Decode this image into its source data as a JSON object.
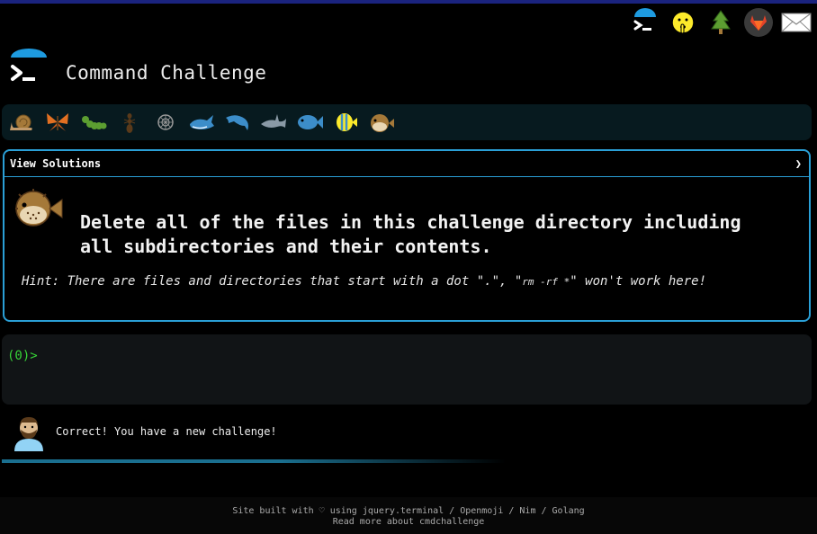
{
  "header": {
    "title": "Command Challenge"
  },
  "top_icons": [
    "terminal-icon",
    "shushing-face-icon",
    "evergreen-tree-icon",
    "gitlab-fox-icon",
    "envelope-icon"
  ],
  "creatures": [
    "snail-icon",
    "butterfly-icon",
    "caterpillar-icon",
    "ant-icon",
    "shell-icon",
    "whale-icon",
    "dolphin-icon",
    "shark-icon",
    "fish-icon",
    "tropical-fish-icon",
    "pufferfish-icon"
  ],
  "panel": {
    "header_label": "View Solutions",
    "chevron": "❯",
    "description": "Delete all of the files in this challenge directory including all subdirectories and their contents.",
    "hint_pre": "Hint: There are files and directories that start with a dot \".\", \"",
    "hint_code": "rm -rf *",
    "hint_post": "\" won't work here!"
  },
  "terminal": {
    "prompt": "(0)>"
  },
  "feedback": {
    "message": "Correct! You have a new challenge!"
  },
  "footer": {
    "line1": "Site built with ♡ using jquery.terminal / Openmoji / Nim / Golang",
    "line2": "Read more about cmdchallenge"
  },
  "colors": {
    "accent": "#2a9fd6",
    "prompt": "#37d437",
    "topbar": "#1a237e"
  }
}
